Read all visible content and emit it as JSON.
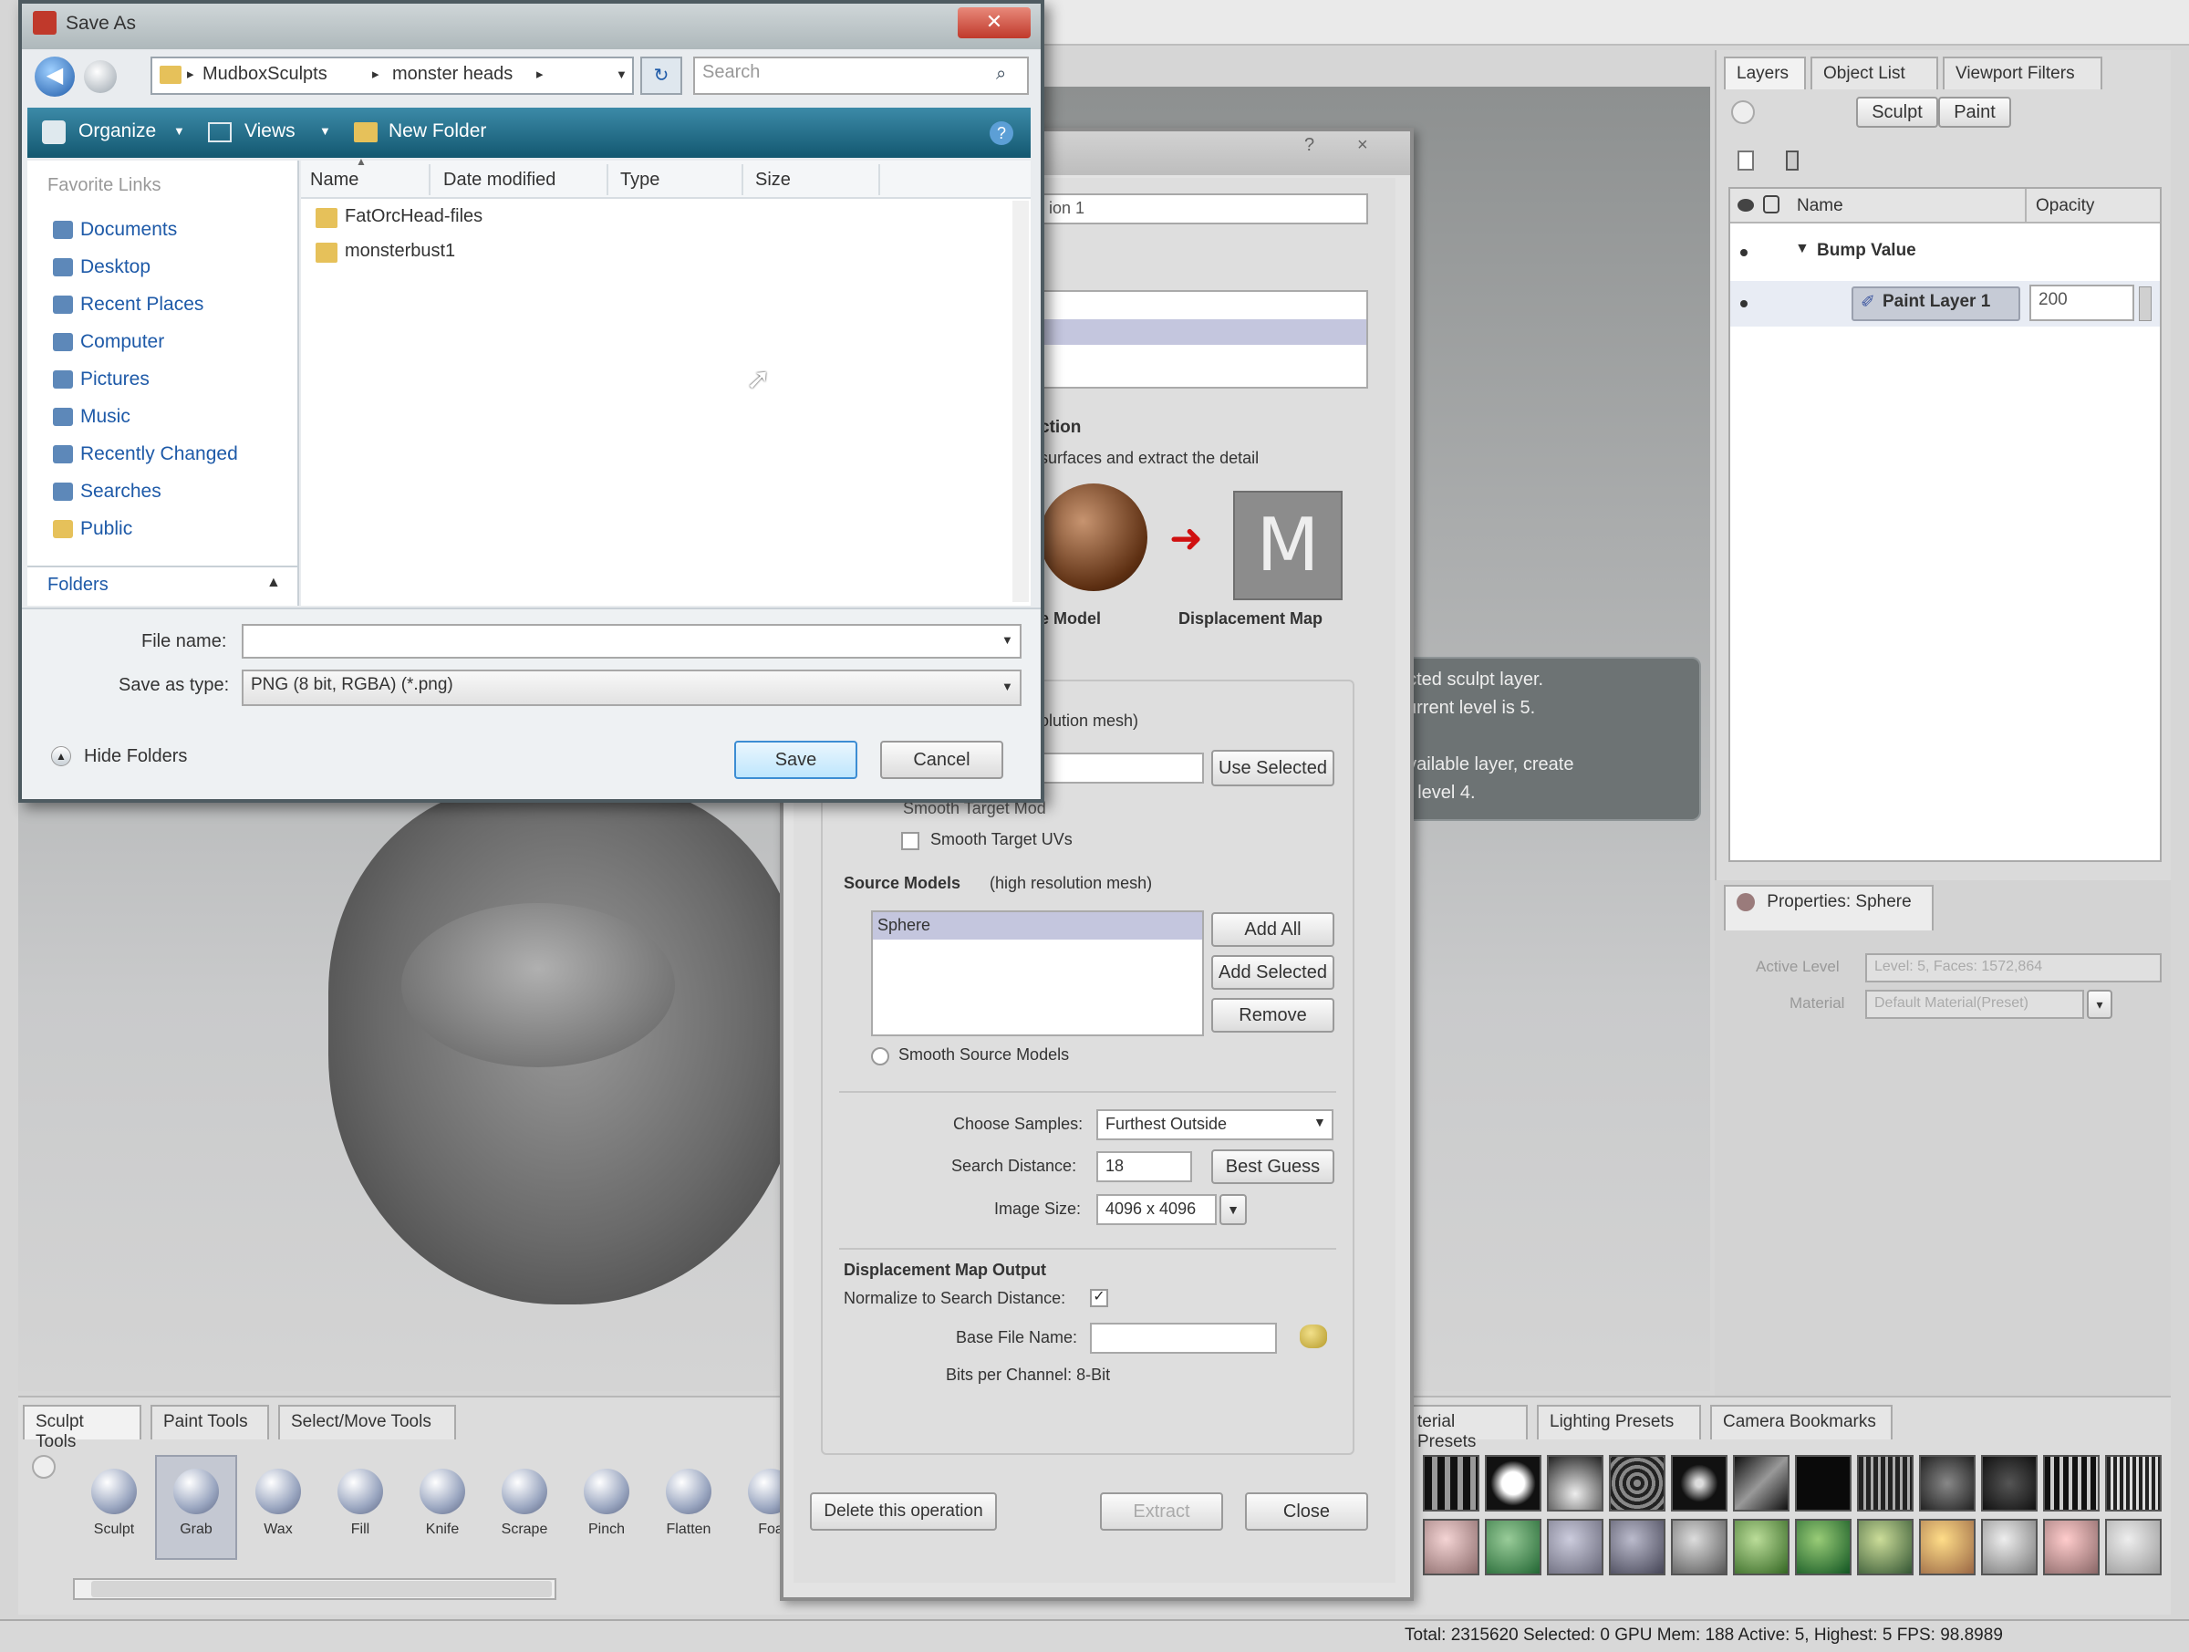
{
  "save_dialog": {
    "title": "Save As",
    "breadcrumb": [
      "MudboxSculpts",
      "monster heads"
    ],
    "search_placeholder": "Search",
    "toolbar": {
      "organize": "Organize",
      "views": "Views",
      "new_folder": "New Folder"
    },
    "favorite_links_title": "Favorite Links",
    "favorites": [
      "Documents",
      "Desktop",
      "Recent Places",
      "Computer",
      "Pictures",
      "Music",
      "Recently Changed",
      "Searches",
      "Public"
    ],
    "folders_label": "Folders",
    "columns": [
      "Name",
      "Date modified",
      "Type",
      "Size"
    ],
    "files": [
      "FatOrcHead-files",
      "monsterbust1"
    ],
    "file_name_label": "File name:",
    "file_name_value": "",
    "save_type_label": "Save as type:",
    "save_type_value": "PNG (8 bit, RGBA) (*.png)",
    "hide_folders": "Hide Folders",
    "save_button": "Save",
    "cancel_button": "Cancel"
  },
  "extract_dialog": {
    "name_value": "ion 1",
    "section_title": "ction",
    "section_desc": "surfaces and extract the detail",
    "model_label": "e Model",
    "map_label": "Displacement Map",
    "target_hint": "olution mesh)",
    "use_selected": "Use Selected",
    "smooth_target_label": "Smooth Target UVs",
    "smooth_target_partial": "Smooth Target Mod",
    "source_models_label": "Source Models",
    "source_models_hint": "(high resolution mesh)",
    "source_models": [
      "Sphere"
    ],
    "add_all": "Add All",
    "add_selected": "Add Selected",
    "remove": "Remove",
    "smooth_source": "Smooth Source Models",
    "choose_samples_label": "Choose Samples:",
    "choose_samples_value": "Furthest Outside",
    "search_distance_label": "Search Distance:",
    "search_distance_value": "18",
    "best_guess": "Best Guess",
    "image_size_label": "Image Size:",
    "image_size_value": "4096 x 4096",
    "output_title": "Displacement Map Output",
    "normalize_label": "Normalize to Search Distance:",
    "base_file_label": "Base File Name:",
    "bits_label": "Bits per Channel: 8-Bit",
    "delete_op": "Delete this operation",
    "extract": "Extract",
    "close": "Close"
  },
  "tooltip": {
    "lines": [
      "ected sculpt layer.",
      "current level is 5.",
      "",
      "available layer, create",
      "to level 4."
    ]
  },
  "right_panel": {
    "tabs": [
      "Layers",
      "Object List",
      "Viewport Filters"
    ],
    "mode_tabs": [
      "Sculpt",
      "Paint"
    ],
    "columns": [
      "Name",
      "Opacity"
    ],
    "rows": [
      {
        "name": "Bump Value",
        "opacity": ""
      },
      {
        "name": "Paint Layer 1",
        "opacity": "200"
      }
    ],
    "properties_tab": "Properties: Sphere",
    "active_level_label": "Active Level",
    "active_level_value": "Level: 5, Faces: 1572,864",
    "material_label": "Material",
    "material_value": "Default Material(Preset)"
  },
  "bottom": {
    "tool_tabs": [
      "Sculpt Tools",
      "Paint Tools",
      "Select/Move Tools"
    ],
    "tools": [
      "Sculpt",
      "Grab",
      "Wax",
      "Fill",
      "Knife",
      "Scrape",
      "Pinch",
      "Flatten",
      "Foa"
    ],
    "preset_tabs": [
      "terial Presets",
      "Lighting Presets",
      "Camera Bookmarks"
    ],
    "status": "Total: 2315620  Selected: 0  GPU Mem: 188  Active: 5, Highest: 5  FPS: 98.8989"
  }
}
